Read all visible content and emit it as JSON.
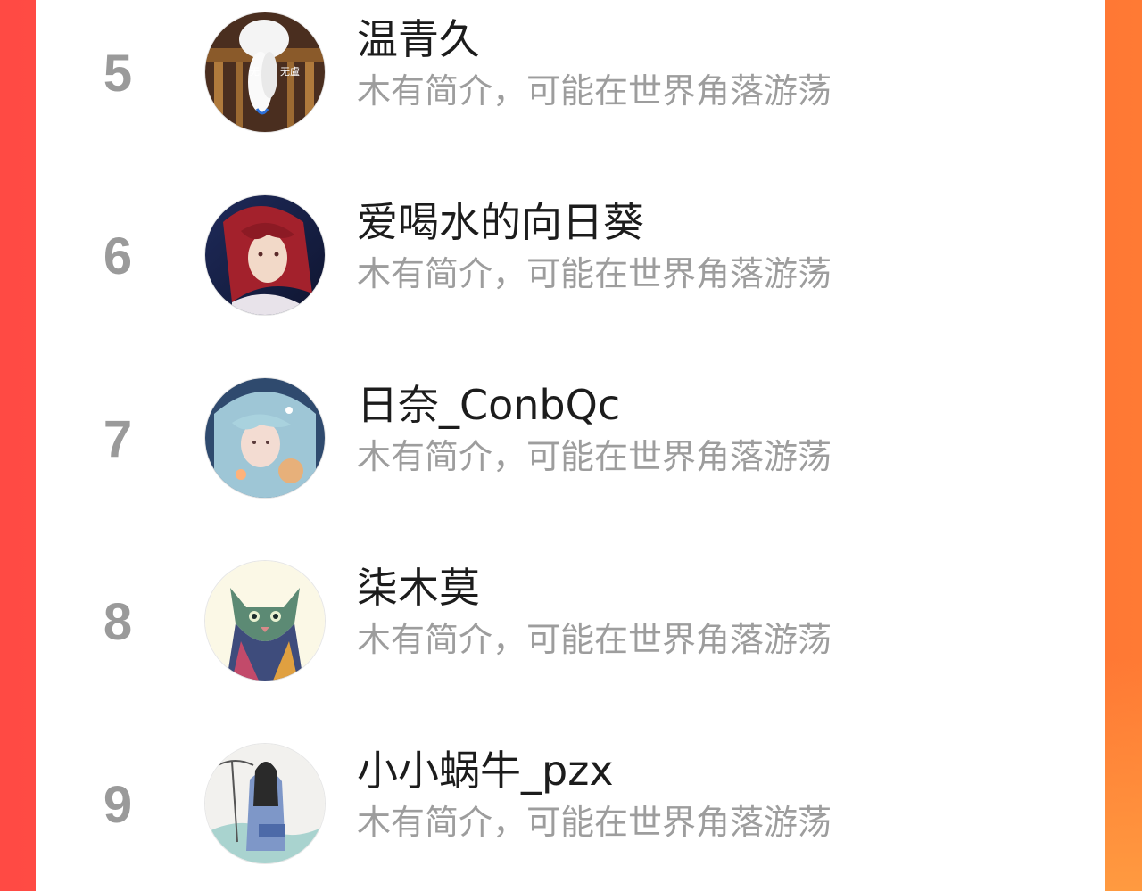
{
  "colors": {
    "background_left": "#ff4a44",
    "background_right": "#ff7a34",
    "card": "#ffffff",
    "rank": "#9a9a9a",
    "name": "#1c1c1c",
    "bio": "#9d9d9d"
  },
  "leaderboard": {
    "entries": [
      {
        "rank": "5",
        "name": "温青久",
        "bio": "木有简介，可能在世界角落游荡",
        "avatar_icon": "white-fox-avatar",
        "avatar_text_left": "无",
        "avatar_text_right": "无盧"
      },
      {
        "rank": "6",
        "name": "爱喝水的向日葵",
        "bio": "木有简介，可能在世界角落游荡",
        "avatar_icon": "red-hair-man-avatar"
      },
      {
        "rank": "7",
        "name": "日奈_ConbQc",
        "bio": "木有简介，可能在世界角落游荡",
        "avatar_icon": "blue-hair-girl-avatar"
      },
      {
        "rank": "8",
        "name": "柒木莫",
        "bio": "木有简介，可能在世界角落游荡",
        "avatar_icon": "kitten-avatar"
      },
      {
        "rank": "9",
        "name": "小小蜗牛_pzx",
        "bio": "木有简介，可能在世界角落游荡",
        "avatar_icon": "ancient-swordsman-avatar"
      }
    ]
  }
}
